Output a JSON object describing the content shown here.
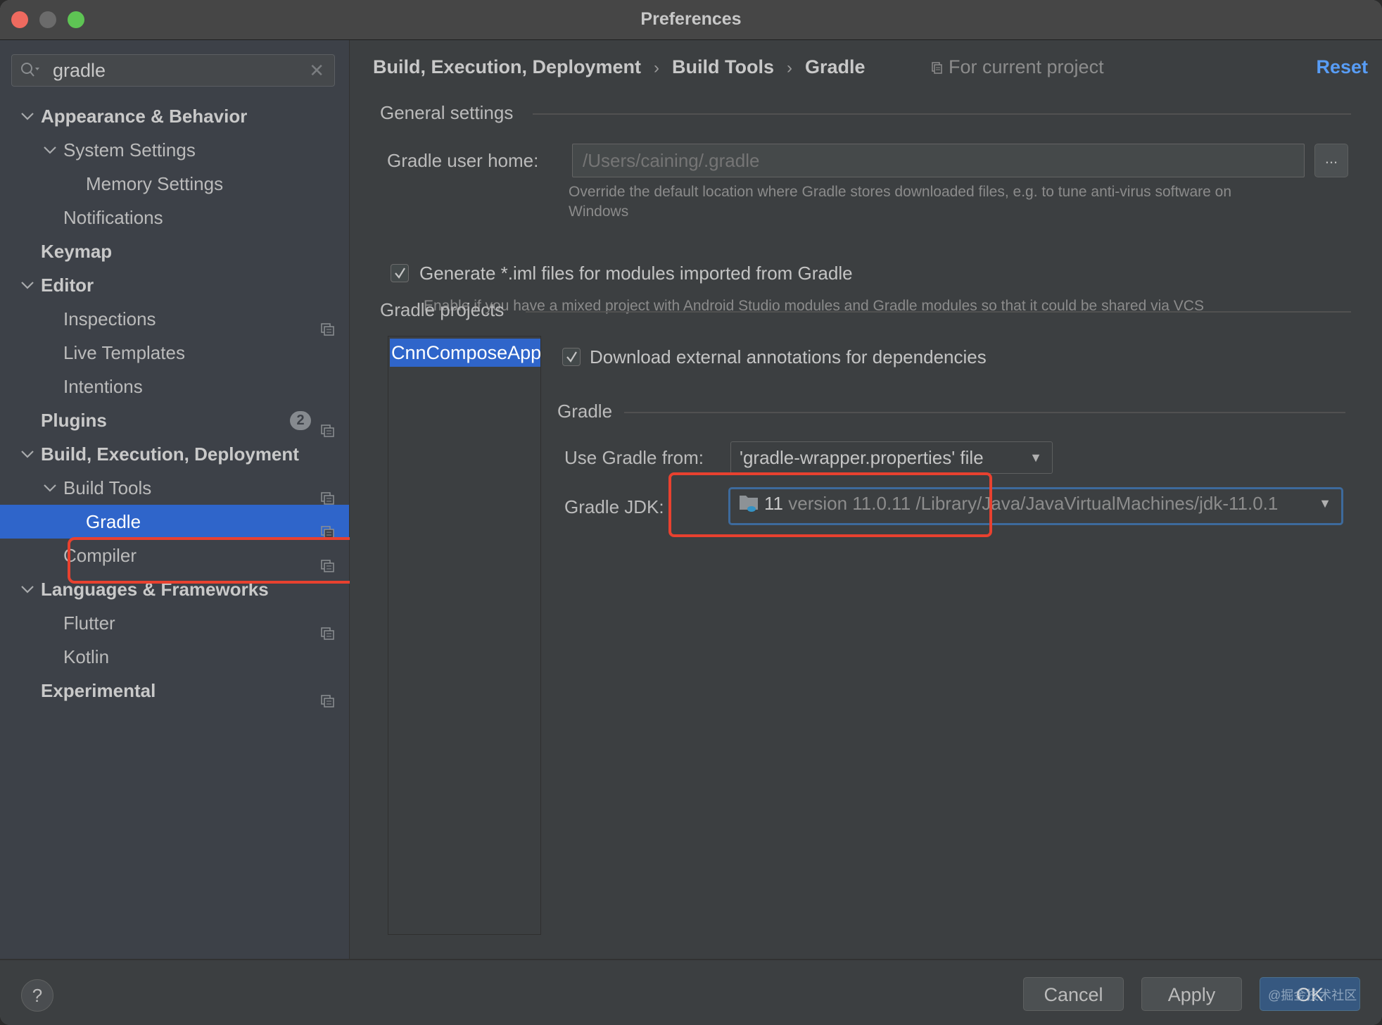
{
  "window": {
    "title": "Preferences"
  },
  "search": {
    "value": "gradle",
    "placeholder": ""
  },
  "sidebar": {
    "items": [
      {
        "label": "Appearance & Behavior",
        "level": 0,
        "bold": true,
        "expanded": true
      },
      {
        "label": "System Settings",
        "level": 1,
        "bold": false,
        "expanded": true
      },
      {
        "label": "Memory Settings",
        "level": 2,
        "bold": false
      },
      {
        "label": "Notifications",
        "level": 1,
        "bold": false
      },
      {
        "label": "Keymap",
        "level": 0,
        "bold": true
      },
      {
        "label": "Editor",
        "level": 0,
        "bold": true,
        "expanded": true
      },
      {
        "label": "Inspections",
        "level": 1,
        "bold": false,
        "project_icon": true
      },
      {
        "label": "Live Templates",
        "level": 1,
        "bold": false
      },
      {
        "label": "Intentions",
        "level": 1,
        "bold": false
      },
      {
        "label": "Plugins",
        "level": 0,
        "bold": true,
        "badge": "2",
        "project_icon": true
      },
      {
        "label": "Build, Execution, Deployment",
        "level": 0,
        "bold": true,
        "expanded": true
      },
      {
        "label": "Build Tools",
        "level": 1,
        "bold": false,
        "expanded": true,
        "project_icon": true
      },
      {
        "label": "Gradle",
        "level": 2,
        "bold": false,
        "selected": true,
        "project_icon": true
      },
      {
        "label": "Compiler",
        "level": 1,
        "bold": false,
        "project_icon": true
      },
      {
        "label": "Languages & Frameworks",
        "level": 0,
        "bold": true,
        "expanded": true
      },
      {
        "label": "Flutter",
        "level": 1,
        "bold": false,
        "project_icon": true
      },
      {
        "label": "Kotlin",
        "level": 1,
        "bold": false
      },
      {
        "label": "Experimental",
        "level": 0,
        "bold": true,
        "project_icon": true
      }
    ]
  },
  "header": {
    "breadcrumb": [
      "Build, Execution, Deployment",
      "Build Tools",
      "Gradle"
    ],
    "separator": "›",
    "scope": "For current project",
    "reset": "Reset"
  },
  "general": {
    "title": "General settings",
    "user_home_label": "Gradle user home:",
    "user_home_value": "/Users/caining/.gradle",
    "browse_label": "...",
    "user_home_hint_line1": "Override the default location where Gradle stores downloaded files, e.g. to tune anti-virus software on",
    "user_home_hint_line2": "Windows",
    "generate_iml_label": "Generate *.iml files for modules imported from Gradle",
    "generate_iml_checked": true,
    "generate_iml_hint": "Enable if you have a mixed project with Android Studio modules and Gradle modules so that it could be shared via VCS"
  },
  "projects": {
    "title": "Gradle projects",
    "list": [
      "CnnComposeApp"
    ],
    "download_annotations_label": "Download external annotations for dependencies",
    "download_annotations_checked": true,
    "gradle_section_title": "Gradle",
    "use_gradle_from_label": "Use Gradle from:",
    "use_gradle_from_value": "'gradle-wrapper.properties' file",
    "gradle_jdk_label": "Gradle JDK:",
    "gradle_jdk_name": "11",
    "gradle_jdk_detail": "version 11.0.11 /Library/Java/JavaVirtualMachines/jdk-11.0.1"
  },
  "footer": {
    "help": "?",
    "cancel": "Cancel",
    "apply": "Apply",
    "ok": "OK",
    "watermark": "@掘金技术社区"
  },
  "colors": {
    "accent": "#2f65ca",
    "link": "#589df6",
    "annotation_red": "#e8412f",
    "ok_button": "#365880"
  }
}
